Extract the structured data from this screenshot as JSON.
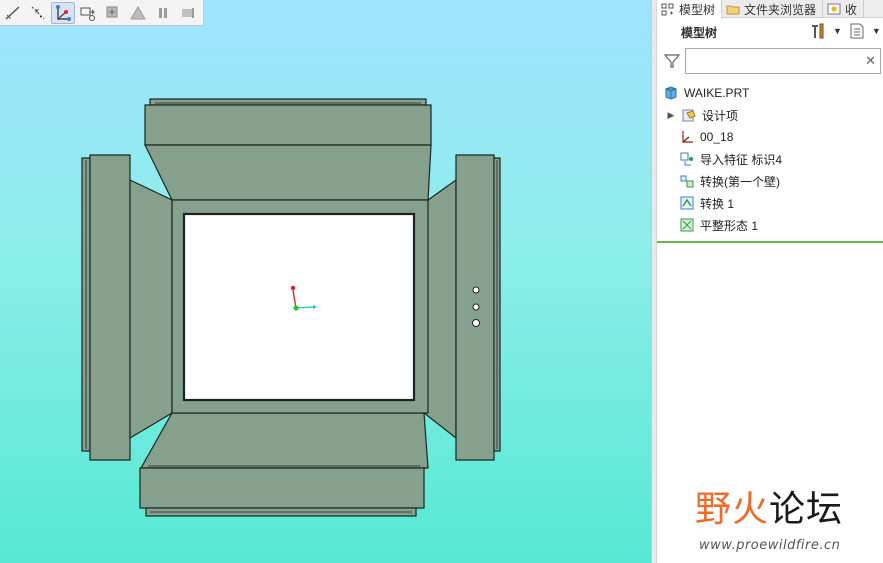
{
  "toolbar": {
    "buttons": [
      {
        "icon": "sketch-line-icon"
      },
      {
        "icon": "dimension-icon"
      },
      {
        "icon": "datum-csys-icon",
        "active": true
      },
      {
        "icon": "datum-plane-icon"
      },
      {
        "icon": "spin-center-icon"
      },
      {
        "icon": "warning-icon"
      },
      {
        "icon": "pause-icon"
      },
      {
        "icon": "skip-icon"
      }
    ]
  },
  "tabs": [
    {
      "label": "模型树",
      "icon": "model-tree-icon",
      "active": true
    },
    {
      "label": "文件夹浏览器",
      "icon": "folder-browser-icon",
      "active": false
    },
    {
      "label": "收",
      "icon": "favorites-icon",
      "active": false
    }
  ],
  "tree": {
    "title": "模型树",
    "filter_placeholder": "",
    "filter_value": "",
    "items": [
      {
        "label": "WAIKE.PRT",
        "icon": "part-icon",
        "expandable": false,
        "level": 0
      },
      {
        "label": "设计项",
        "icon": "design-items-icon",
        "expandable": true,
        "level": 1
      },
      {
        "label": "00_18",
        "icon": "coordinate-system-icon",
        "expandable": false,
        "level": 1
      },
      {
        "label": "导入特征 标识4",
        "icon": "import-feature-icon",
        "expandable": false,
        "level": 1
      },
      {
        "label": "转换(第一个壁)",
        "icon": "convert-first-wall-icon",
        "expandable": false,
        "level": 1
      },
      {
        "label": "转换 1",
        "icon": "convert-icon",
        "expandable": false,
        "level": 1
      },
      {
        "label": "平整形态 1",
        "icon": "flat-state-icon",
        "expandable": false,
        "level": 1
      }
    ]
  },
  "watermark": {
    "text_a": "野火",
    "text_b": "论坛",
    "url": "www.proewildfire.cn"
  },
  "colors": {
    "sheet_metal": "#86a08e",
    "edge": "#1c2420",
    "insert_line": "#62b84a",
    "accent_orange": "#f06a2a"
  }
}
